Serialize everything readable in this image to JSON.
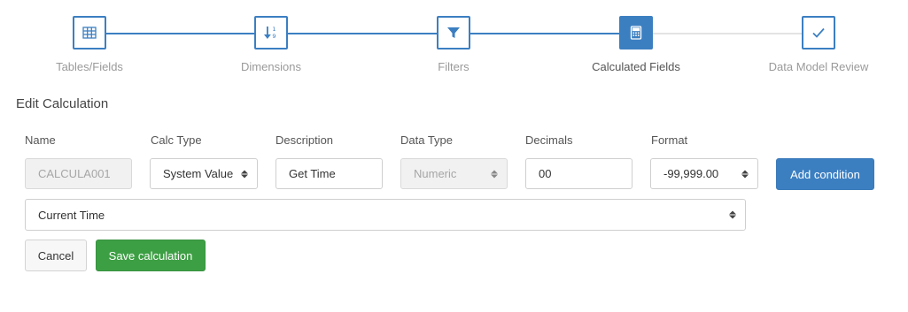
{
  "wizard": {
    "steps": [
      {
        "label": "Tables/Fields",
        "icon": "table-icon",
        "state": "done"
      },
      {
        "label": "Dimensions",
        "icon": "sort-numeric-icon",
        "state": "done"
      },
      {
        "label": "Filters",
        "icon": "filter-icon",
        "state": "done"
      },
      {
        "label": "Calculated Fields",
        "icon": "calculator-icon",
        "state": "active"
      },
      {
        "label": "Data Model Review",
        "icon": "check-icon",
        "state": "todo"
      }
    ],
    "colors": {
      "accent": "#3c7fc1",
      "inactive_line": "#e3e3e3"
    }
  },
  "form": {
    "title": "Edit Calculation",
    "fields": {
      "name": {
        "label": "Name",
        "value": "CALCULA001",
        "disabled": true
      },
      "calc_type": {
        "label": "Calc Type",
        "value": "System Value"
      },
      "description": {
        "label": "Description",
        "value": "Get Time"
      },
      "data_type": {
        "label": "Data Type",
        "value": "Numeric",
        "disabled": true
      },
      "decimals": {
        "label": "Decimals",
        "value": "00"
      },
      "format": {
        "label": "Format",
        "value": "-99,999.00"
      }
    },
    "system_value": {
      "value": "Current Time"
    },
    "buttons": {
      "add_condition": "Add condition",
      "cancel": "Cancel",
      "save": "Save calculation"
    },
    "colors": {
      "primary": "#3c7fc1",
      "success": "#3d9f44"
    }
  }
}
